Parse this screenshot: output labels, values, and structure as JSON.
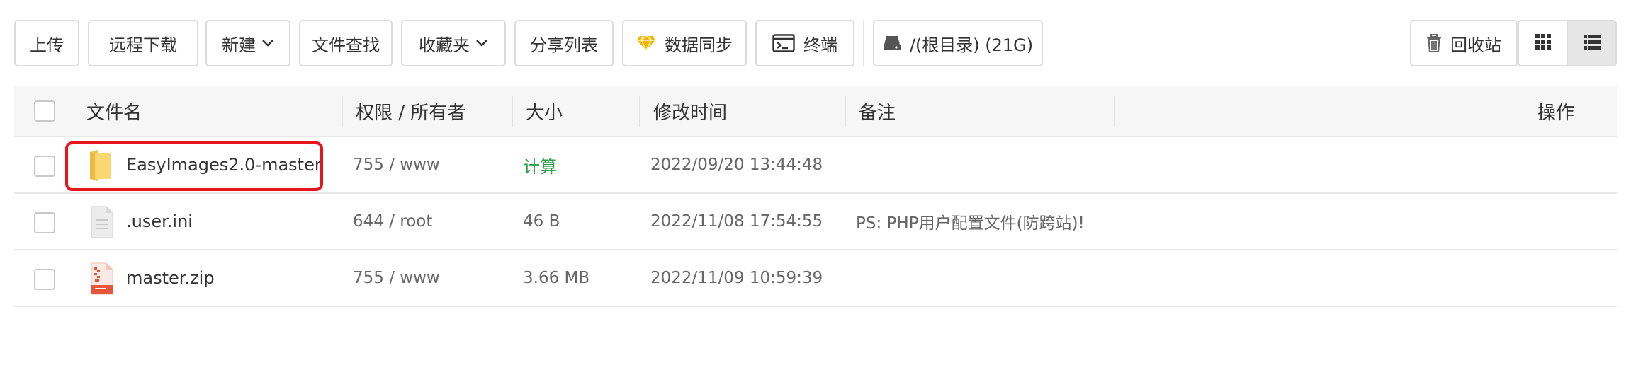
{
  "toolbar": {
    "upload": "上传",
    "remote_download": "远程下载",
    "new": "新建",
    "file_search": "文件查找",
    "favorites": "收藏夹",
    "share_list": "分享列表",
    "data_sync": "数据同步",
    "terminal": "终端",
    "disk": "/(根目录) (21G)",
    "recycle_bin": "回收站",
    "accent_gold": "#f5b400"
  },
  "table": {
    "headers": {
      "name": "文件名",
      "permission_owner": "权限 / 所有者",
      "size": "大小",
      "modified": "修改时间",
      "remark": "备注",
      "actions": "操作"
    },
    "rows": [
      {
        "name": "EasyImages2.0-master",
        "icon": "folder-icon",
        "perm": "755 / www",
        "size": "计算",
        "modified": "2022/09/20 13:44:48",
        "remark": ""
      },
      {
        "name": ".user.ini",
        "icon": "text-file-icon",
        "perm": "644 / root",
        "size": "46 B",
        "modified": "2022/11/08 17:54:55",
        "remark": "PS: PHP用户配置文件(防跨站)!"
      },
      {
        "name": "master.zip",
        "icon": "zip-file-icon",
        "perm": "755 / www",
        "size": "3.66 MB",
        "modified": "2022/11/09 10:59:39",
        "remark": ""
      }
    ],
    "size_link_color": "#2e9e4a",
    "highlight_color": "#e8141c"
  }
}
